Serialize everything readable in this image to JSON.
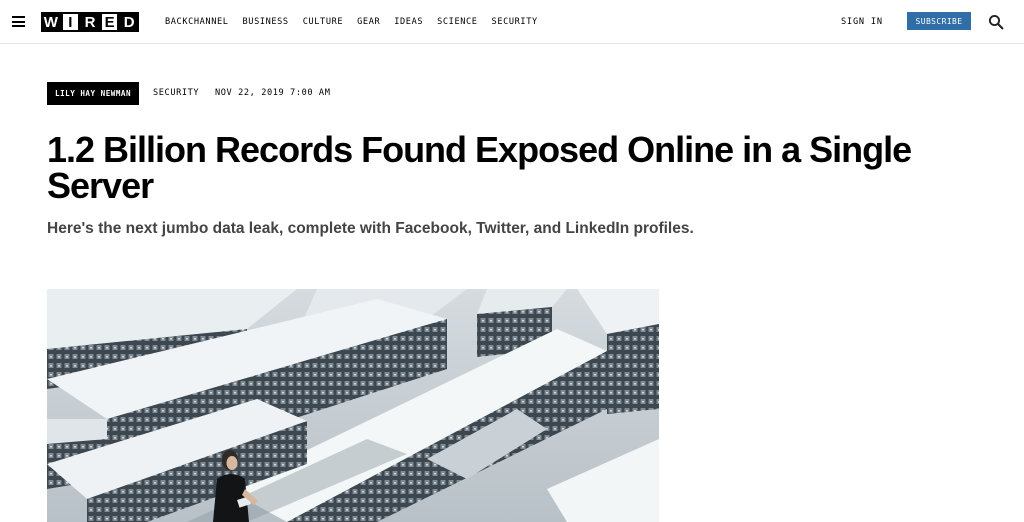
{
  "header": {
    "logo_letters": [
      "W",
      "I",
      "R",
      "E",
      "D"
    ],
    "nav": [
      "BACKCHANNEL",
      "BUSINESS",
      "CULTURE",
      "GEAR",
      "IDEAS",
      "SCIENCE",
      "SECURITY"
    ],
    "sign_in": "SIGN IN",
    "subscribe": "SUBSCRIBE",
    "icons": {
      "menu": "hamburger-icon",
      "search": "search-icon"
    }
  },
  "article": {
    "author": "LILY HAY NEWMAN",
    "category": "SECURITY",
    "date": "NOV 22, 2019 7:00 AM",
    "title": "1.2 Billion Records Found Exposed Online in a Single Server",
    "dek": "Here's the next jumbo data leak, complete with Facebook, Twitter, and LinkedIn profiles."
  },
  "colors": {
    "subscribe_bg": "#2f6ea6",
    "byline_bg": "#000000",
    "dek_text": "#444444"
  }
}
